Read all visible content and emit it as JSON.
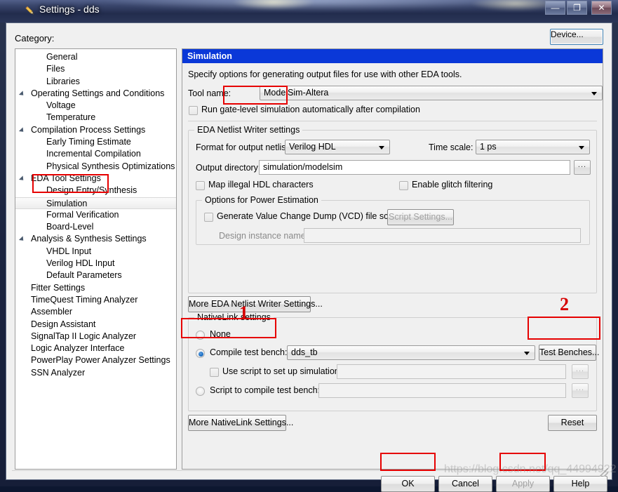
{
  "window": {
    "title": "Settings - dds",
    "icon": "pencil-icon",
    "minimize_label": "—",
    "maximize_label": "❐",
    "close_label": "✕"
  },
  "category": {
    "label": "Category:",
    "selected": "Simulation",
    "items": [
      {
        "label": "General",
        "level": 1,
        "expandable": false
      },
      {
        "label": "Files",
        "level": 1,
        "expandable": false
      },
      {
        "label": "Libraries",
        "level": 1,
        "expandable": false
      },
      {
        "label": "Operating Settings and Conditions",
        "level": 0,
        "expandable": true
      },
      {
        "label": "Voltage",
        "level": 1,
        "expandable": false
      },
      {
        "label": "Temperature",
        "level": 1,
        "expandable": false
      },
      {
        "label": "Compilation Process Settings",
        "level": 0,
        "expandable": true
      },
      {
        "label": "Early Timing Estimate",
        "level": 1,
        "expandable": false
      },
      {
        "label": "Incremental Compilation",
        "level": 1,
        "expandable": false
      },
      {
        "label": "Physical Synthesis Optimizations",
        "level": 1,
        "expandable": false
      },
      {
        "label": "EDA Tool Settings",
        "level": 0,
        "expandable": true
      },
      {
        "label": "Design Entry/Synthesis",
        "level": 1,
        "expandable": false
      },
      {
        "label": "Simulation",
        "level": 1,
        "expandable": false
      },
      {
        "label": "Formal Verification",
        "level": 1,
        "expandable": false
      },
      {
        "label": "Board-Level",
        "level": 1,
        "expandable": false
      },
      {
        "label": "Analysis & Synthesis Settings",
        "level": 0,
        "expandable": true
      },
      {
        "label": "VHDL Input",
        "level": 1,
        "expandable": false
      },
      {
        "label": "Verilog HDL Input",
        "level": 1,
        "expandable": false
      },
      {
        "label": "Default Parameters",
        "level": 1,
        "expandable": false
      },
      {
        "label": "Fitter Settings",
        "level": 0,
        "expandable": false
      },
      {
        "label": "TimeQuest Timing Analyzer",
        "level": 0,
        "expandable": false
      },
      {
        "label": "Assembler",
        "level": 0,
        "expandable": false
      },
      {
        "label": "Design Assistant",
        "level": 0,
        "expandable": false
      },
      {
        "label": "SignalTap II Logic Analyzer",
        "level": 0,
        "expandable": false
      },
      {
        "label": "Logic Analyzer Interface",
        "level": 0,
        "expandable": false
      },
      {
        "label": "PowerPlay Power Analyzer Settings",
        "level": 0,
        "expandable": false
      },
      {
        "label": "SSN Analyzer",
        "level": 0,
        "expandable": false
      }
    ]
  },
  "device_button": {
    "label": "Device..."
  },
  "pane": {
    "header": "Simulation",
    "description": "Specify options for generating output files for use with other EDA tools.",
    "tool_name": {
      "label": "Tool name:",
      "value": "ModelSim-Altera"
    },
    "run_gate_level": {
      "label": "Run gate-level simulation automatically after compilation",
      "checked": false
    },
    "eda_netlist": {
      "title": "EDA Netlist Writer settings",
      "format_label": "Format for output netlist:",
      "format_value": "Verilog HDL",
      "timescale_label": "Time scale:",
      "timescale_value": "1 ps",
      "output_dir_label": "Output directory:",
      "output_dir_value": "simulation/modelsim",
      "browse_label": "...",
      "map_illegal_label": "Map illegal HDL characters",
      "map_illegal_checked": false,
      "glitch_label": "Enable glitch filtering",
      "glitch_checked": false,
      "power": {
        "title": "Options for Power Estimation",
        "vcd_label": "Generate Value Change Dump (VCD) file script",
        "vcd_checked": false,
        "script_settings_label": "Script Settings...",
        "design_instance_label": "Design instance name:",
        "design_instance_value": ""
      }
    },
    "more_eda_button": {
      "label": "More EDA Netlist Writer Settings..."
    },
    "nativelink": {
      "title": "NativeLink settings",
      "none_label": "None",
      "none_selected": false,
      "compile_tb_label": "Compile test bench:",
      "compile_tb_selected": true,
      "compile_tb_value": "dds_tb",
      "test_benches_label": "Test Benches...",
      "use_script_label": "Use script to set up simulation:",
      "use_script_checked": false,
      "use_script_value": "",
      "script_compile_label": "Script to compile test bench:",
      "script_compile_selected": false,
      "script_compile_value": "",
      "browse_label": "..."
    },
    "more_nativelink_button": {
      "label": "More NativeLink Settings..."
    },
    "reset_button": {
      "label": "Reset"
    }
  },
  "footer": {
    "ok_label": "OK",
    "cancel_label": "Cancel",
    "apply_label": "Apply",
    "apply_disabled": true,
    "help_label": "Help"
  },
  "annotations": {
    "marker_1": "1",
    "marker_2": "2"
  },
  "watermark": {
    "text": "https://blog.csdn.net/qq_44994922"
  },
  "colors": {
    "pane_header_bg": "#0a38d8",
    "annotation_red": "#e60000",
    "titlebar_dark": "#222c4d",
    "focus_blue": "#3c7fb1"
  }
}
